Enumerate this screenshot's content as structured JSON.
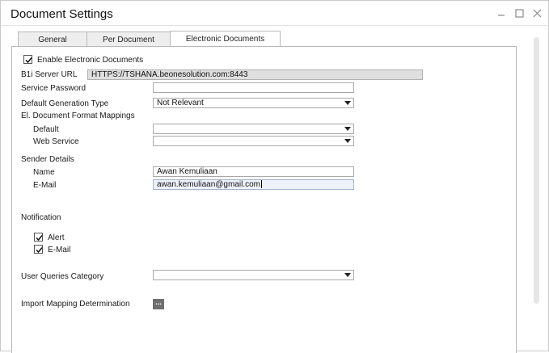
{
  "window": {
    "title": "Document Settings",
    "minimize_icon": "minimize-icon",
    "maximize_icon": "maximize-icon",
    "close_icon": "close-icon"
  },
  "tabs": [
    {
      "label": "General",
      "selected": false
    },
    {
      "label": "Per Document",
      "selected": false
    },
    {
      "label": "Electronic Documents",
      "selected": true
    }
  ],
  "form": {
    "enable_label": "Enable Electronic Documents",
    "enable_checked": true,
    "b1i_label": "B1i Server URL",
    "b1i_value": "HTTPS://TSHANA.beonesolution.com:8443",
    "service_password_label": "Service Password",
    "service_password_value": "",
    "default_generation_label": "Default Generation Type",
    "default_generation_value": "Not Relevant",
    "format_mappings_label": "El. Document Format Mappings",
    "default_label": "Default",
    "default_value": "",
    "web_service_label": "Web Service",
    "web_service_value": "",
    "sender_details_label": "Sender Details",
    "name_label": "Name",
    "name_value": "Awan Kemuliaan",
    "email_label": "E-Mail",
    "email_value": "awan.kemuliaan@gmail.com",
    "notification_label": "Notification",
    "alert_label": "Alert",
    "alert_checked": true,
    "notif_email_label": "E-Mail",
    "notif_email_checked": true,
    "user_queries_label": "User Queries Category",
    "user_queries_value": "",
    "import_mapping_label": "Import Mapping Determination",
    "import_mapping_button": "..."
  }
}
